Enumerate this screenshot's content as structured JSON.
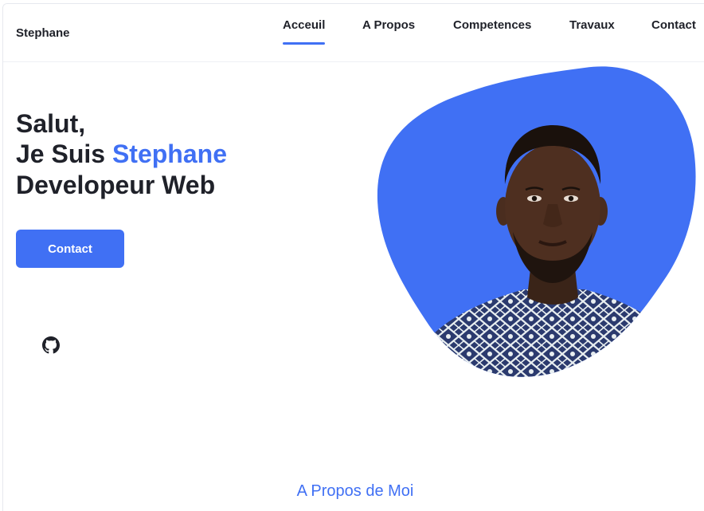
{
  "brand": "Stephane",
  "nav": {
    "items": [
      {
        "label": "Acceuil",
        "active": true
      },
      {
        "label": "A Propos",
        "active": false
      },
      {
        "label": "Competences",
        "active": false
      },
      {
        "label": "Travaux",
        "active": false
      },
      {
        "label": "Contact",
        "active": false
      }
    ]
  },
  "hero": {
    "greeting": "Salut,",
    "intro_prefix": "Je Suis ",
    "name": "Stephane",
    "role": "Developeur Web",
    "cta_label": "Contact",
    "social_icon": "github-icon",
    "photo_icon": "profile-photo"
  },
  "about": {
    "title": "A Propos de Moi"
  },
  "colors": {
    "accent": "#4070f4",
    "text": "#1f2129",
    "background": "#ffffff"
  }
}
